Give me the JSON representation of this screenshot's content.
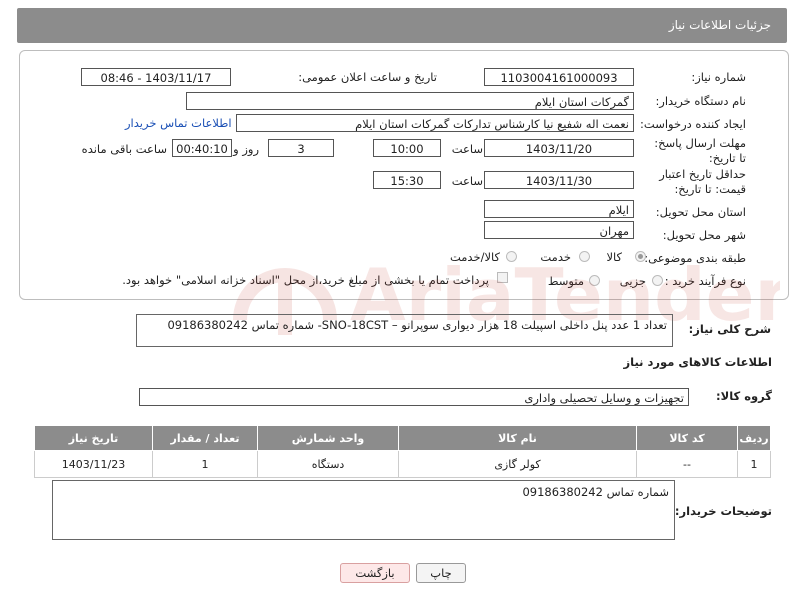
{
  "header": {
    "title": "جزئیات اطلاعات نیاز"
  },
  "form": {
    "need_number_label": "شماره نیاز:",
    "need_number": "1103004161000093",
    "announce_label": "تاریخ و ساعت اعلان عمومی:",
    "announce_value": "1403/11/17 - 08:46",
    "buyer_org_label": "نام دستگاه خریدار:",
    "buyer_org": "گمرکات استان ایلام",
    "requester_label": "ایجاد کننده درخواست:",
    "requester": "نعمت اله شفیع نیا کارشناس تدارکات گمرکات استان ایلام",
    "buyer_contact_link": "اطلاعات تماس خریدار",
    "deadline_label": "مهلت ارسال پاسخ: تا تاریخ:",
    "deadline_date": "1403/11/20",
    "time_label": "ساعت",
    "deadline_time": "10:00",
    "days": "3",
    "days_and_label": "روز و",
    "remaining": "00:40:10",
    "remaining_label": "ساعت باقی مانده",
    "min_price_label": "حداقل تاریخ اعتبار قیمت: تا تاریخ:",
    "min_price_date": "1403/11/30",
    "min_price_time": "15:30",
    "province_label": "استان محل تحویل:",
    "province": "ایلام",
    "city_label": "شهر محل تحویل:",
    "city": "مهران",
    "category_label": "طبقه بندی موضوعی:",
    "cat_goods": "کالا",
    "cat_service": "خدمت",
    "cat_goods_service": "کالا/خدمت",
    "process_label": "نوع فرآیند خرید :",
    "proc_partial": "جزیی",
    "proc_medium": "متوسط",
    "payment_note": "پرداخت تمام یا بخشی از مبلغ خرید،از محل \"اسناد خزانه اسلامی\" خواهد بود."
  },
  "summary": {
    "label": "شرح کلی نیاز:",
    "value": "تعداد 1  عدد پنل داخلی اسپیلت 18 هزار دیواری سوپرانو – SNO-18CST- شماره تماس 09186380242"
  },
  "goods_section": {
    "title": "اطلاعات کالاهای مورد نیاز",
    "group_label": "گروه کالا:",
    "group_value": "تجهیزات و وسایل تحصیلی واداری"
  },
  "table": {
    "headers": [
      "ردیف",
      "کد کالا",
      "نام کالا",
      "واحد شمارش",
      "تعداد / مقدار",
      "تاریخ نیاز"
    ],
    "rows": [
      [
        "1",
        "--",
        "کولر گازی",
        "دستگاه",
        "1",
        "1403/11/23"
      ]
    ]
  },
  "buyer_notes": {
    "label": "توضیحات خریدار:",
    "value": "شماره تماس 09186380242"
  },
  "buttons": {
    "print": "چاپ",
    "back": "بازگشت"
  },
  "watermark": {
    "text": "AriaTender.net"
  }
}
